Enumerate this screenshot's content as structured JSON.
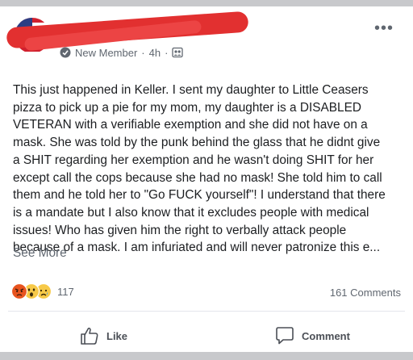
{
  "post": {
    "author_status": "New Member",
    "time": "4h",
    "separator": "·",
    "body": "This just happened in Keller. I sent my daughter to Little Ceasers\npizza to pick up a pie for my mom, my daughter is a DISABLED\nVETERAN with a verifiable exemption and she did not have on a\nmask. She was told by the punk behind the glass that he didnt give\na SHIT regarding her exemption and he wasn't doing SHIT for her\nexcept call the cops because she had no mask! She told him to call\nthem and he told her to \"Go FUCK yourself\"! I understand that there\nis a mandate but I also know that it excludes people with medical\nissues! Who has given him the right to verbally attack people\nbecause of a mask. I am infuriated and will never patronize this e...",
    "see_more": "See More"
  },
  "engagement": {
    "reaction_count": "117",
    "comments": "161 Comments",
    "reactions": [
      "angry-icon",
      "wow-icon",
      "sad-icon"
    ]
  },
  "actions": {
    "like": "Like",
    "comment": "Comment"
  }
}
